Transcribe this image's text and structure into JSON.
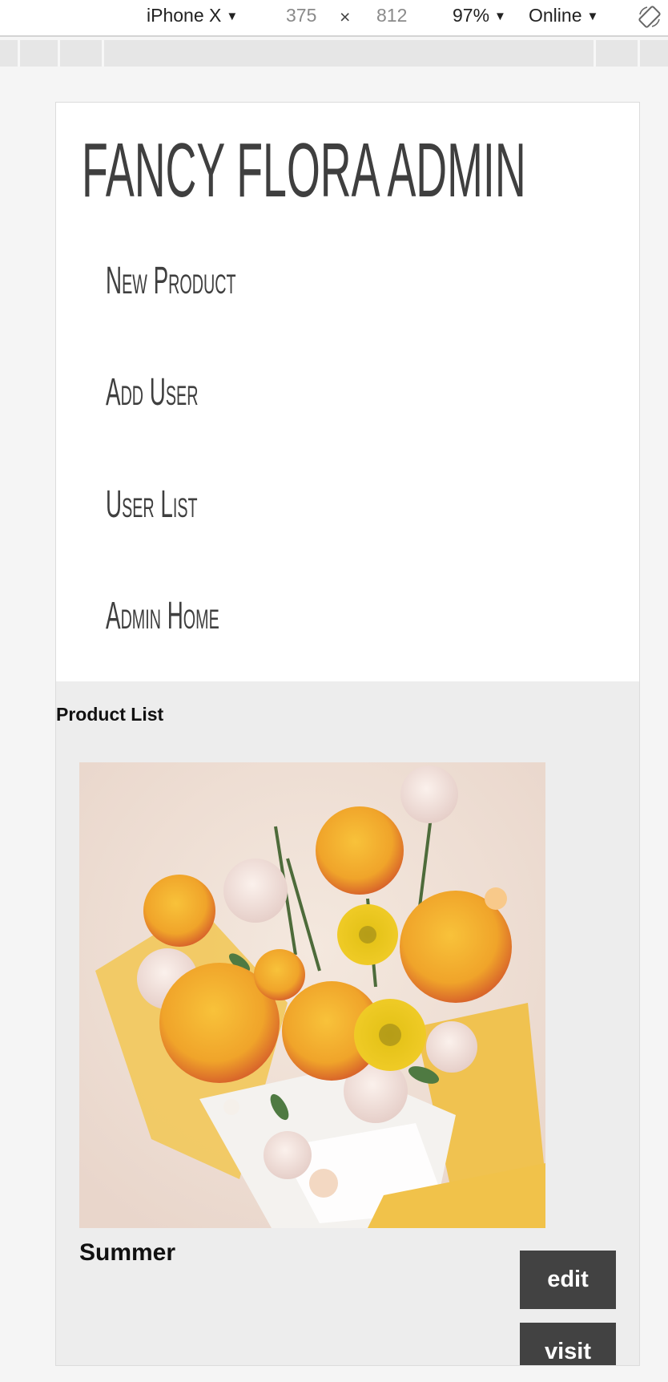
{
  "devtools": {
    "device": "iPhone X",
    "width": "375",
    "separator": "×",
    "height": "812",
    "zoom": "97%",
    "network": "Online"
  },
  "site": {
    "title": "FANCY FLORA ADMIN"
  },
  "nav": [
    {
      "label": "New Product"
    },
    {
      "label": "Add User"
    },
    {
      "label": "User List"
    },
    {
      "label": "Admin Home"
    }
  ],
  "product_list": {
    "heading": "Product List",
    "items": [
      {
        "name": "Summer",
        "edit_label": "edit",
        "visit_label": "visit"
      }
    ]
  },
  "colors": {
    "button_bg": "#424242",
    "page_bg": "#ededed",
    "header_bg": "#ffffff",
    "title_text": "#3f3f3f"
  }
}
